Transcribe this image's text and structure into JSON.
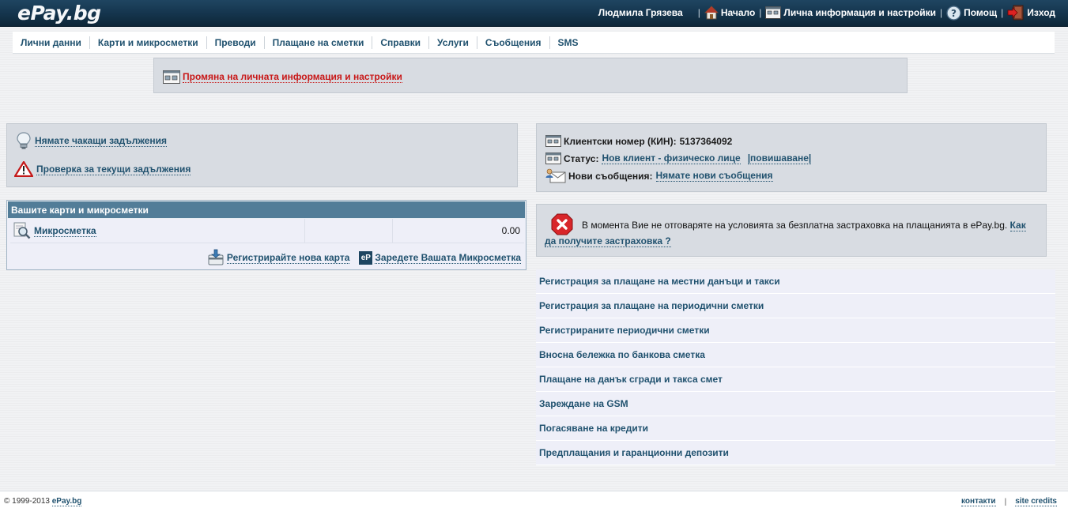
{
  "header": {
    "logo": "ePay.bg",
    "user_name": "Людмила Грязева",
    "home_label": "Начало",
    "settings_label": "Лична информация и настройки",
    "help_label": "Помощ",
    "logout_label": "Изход"
  },
  "nav": {
    "items": [
      {
        "label": "Лични данни"
      },
      {
        "label": "Карти и микросметки"
      },
      {
        "label": "Преводи"
      },
      {
        "label": "Плащане на сметки"
      },
      {
        "label": "Справки"
      },
      {
        "label": "Услуги"
      },
      {
        "label": "Съобщения"
      },
      {
        "label": "SMS"
      }
    ]
  },
  "settings_box": {
    "link": "Промяна на личната информация и настройки"
  },
  "debts": {
    "no_pending": "Нямате чакащи задължения",
    "check_current": "Проверка за текущи задължения"
  },
  "cards": {
    "title": "Вашите карти и микросметки",
    "rows": [
      {
        "name": "Микросметка",
        "info": "",
        "balance": "0.00"
      }
    ],
    "register_card": "Регистрирайте нова карта",
    "topup_icon_text": "eP",
    "topup": "Заредете Вашата Микросметка"
  },
  "client": {
    "number_label": "Клиентски номер (КИН):",
    "number_value": "5137364092",
    "status_label": "Статус:",
    "status_value": "Нов клиент - физическо лице",
    "upgrade_link": "|повишаване|",
    "messages_label": "Нови съобщения:",
    "messages_value": "Нямате нови съобщения"
  },
  "insurance": {
    "text": "В момента Вие не отговаряте на условията за безплатна застраховка на плащанията в ePay.bg.",
    "link": "Как да получите застраховка ?"
  },
  "services": {
    "links": [
      "Регистрация за плащане на местни данъци и такси",
      "Регистрация за плащане на периодични сметки",
      "Регистрираните периодични сметки",
      "Вносна бележка по банкова сметка",
      "Плащане на данък сгради и такса смет",
      "Зареждане на GSM",
      "Погасяване на кредити",
      "Предплащания и гаранционни депозити"
    ]
  },
  "footer": {
    "copyright": "© 1999-2013",
    "brand_link": "ePay.bg",
    "contacts": "контакти",
    "credits": "site credits"
  },
  "colors": {
    "header_bg": "#163750",
    "link": "#21526f",
    "alert_red": "#c81818",
    "panel_bg": "#d8dce2",
    "table_head": "#527d98"
  }
}
